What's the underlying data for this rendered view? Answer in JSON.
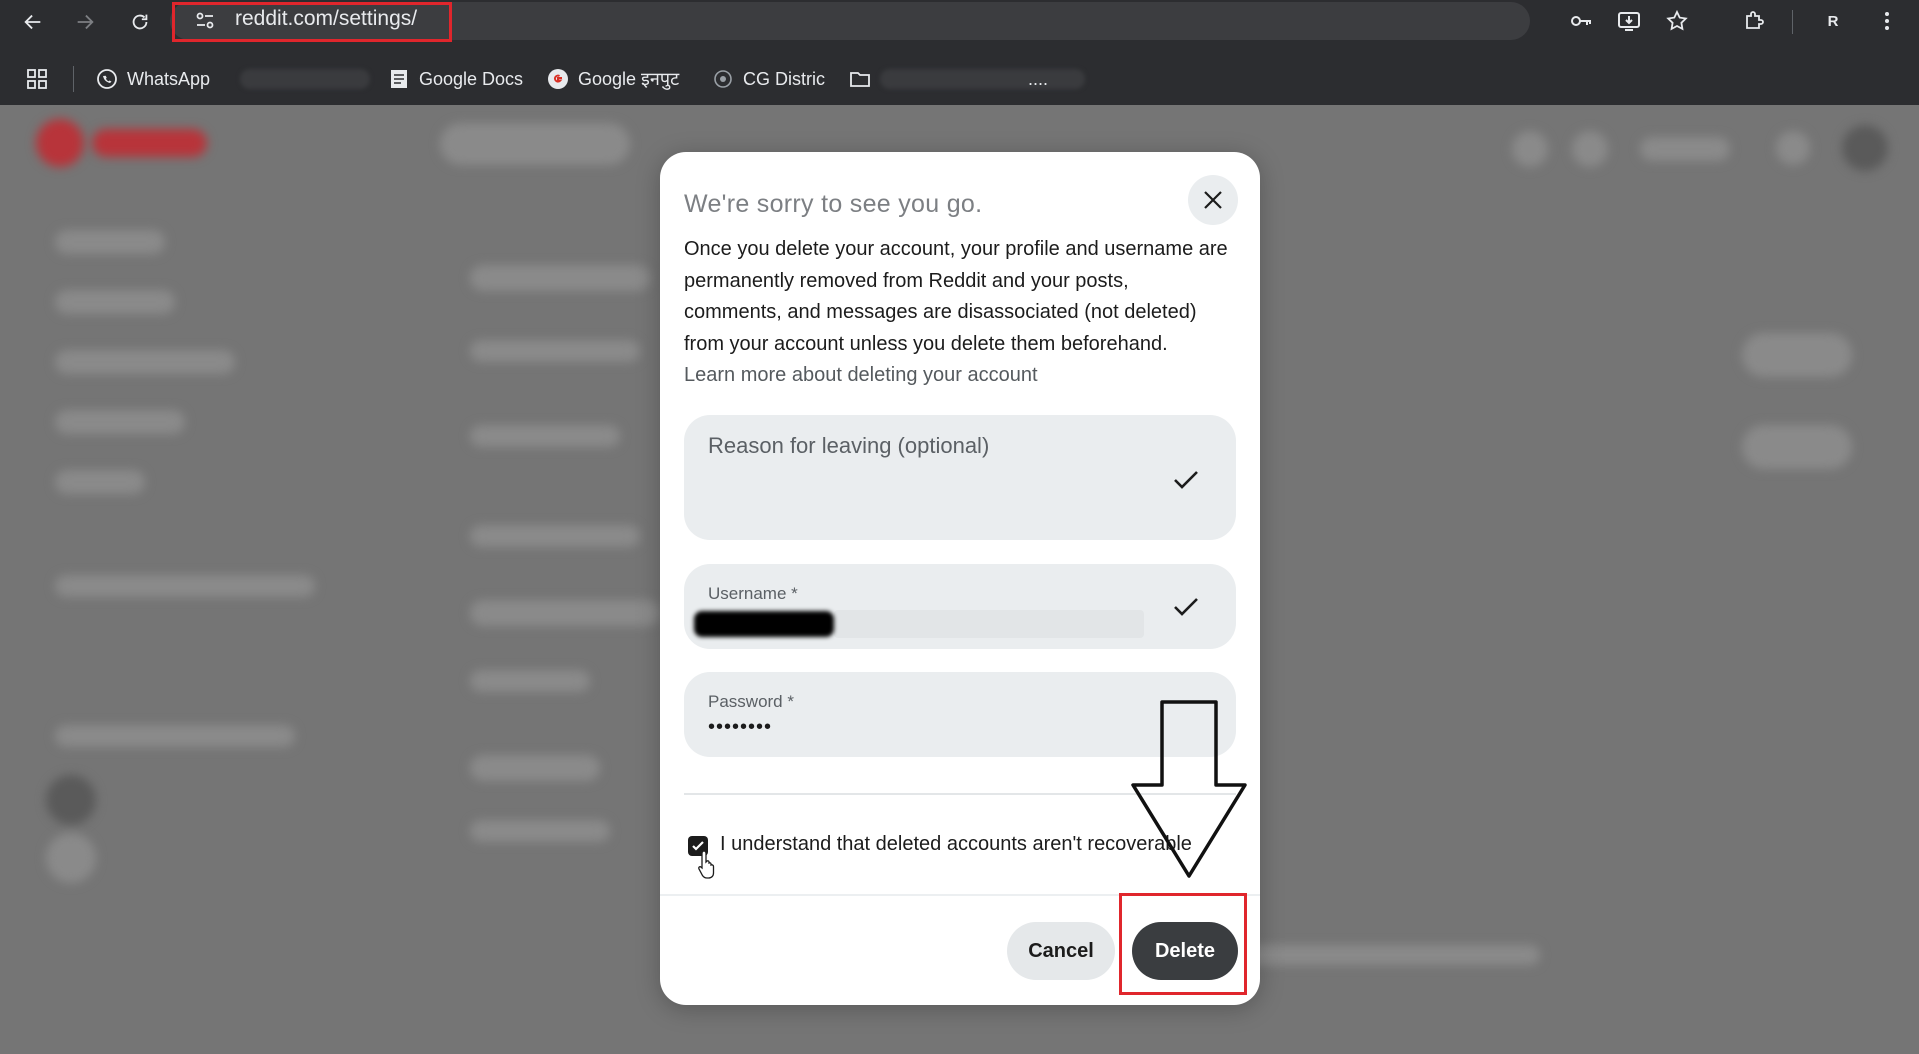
{
  "browser": {
    "url": "reddit.com/settings/",
    "profile_initial": "R",
    "bookmarks": [
      {
        "label": "WhatsApp",
        "icon": "whatsapp-icon"
      },
      {
        "label": "Google Docs",
        "icon": "google-docs-icon"
      },
      {
        "label": "Google इनपुट",
        "icon": "google-icon"
      },
      {
        "label": "CG Distric",
        "icon": "cg-district-icon"
      }
    ],
    "truncated_bookmark_suffix": "...."
  },
  "modal": {
    "title": "We're sorry to see you go.",
    "body": "Once you delete your account, your profile and username are permanently removed from Reddit and your posts, comments, and messages are disassociated (not deleted) from your account unless you delete them beforehand.",
    "learn_more": "Learn more about deleting your account",
    "reason_placeholder": "Reason for leaving (optional)",
    "username_label": "Username *",
    "password_label": "Password *",
    "password_value": "••••••••",
    "acknowledge_label": "I understand that deleted accounts aren't recoverable",
    "acknowledge_checked": true,
    "cancel_label": "Cancel",
    "delete_label": "Delete"
  },
  "colors": {
    "annotation_red": "#e0262c",
    "delete_button": "#3a3d40",
    "field_background": "#eaedef"
  }
}
